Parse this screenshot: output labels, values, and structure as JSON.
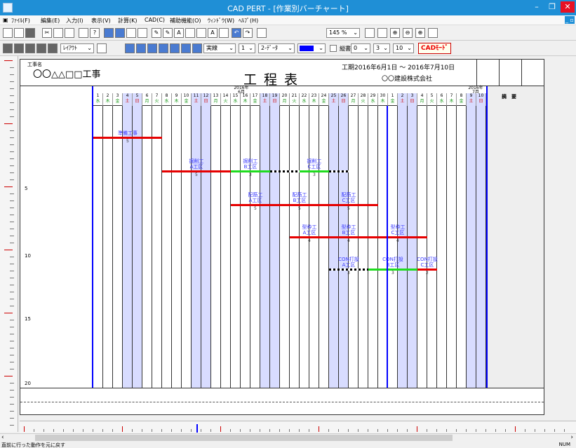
{
  "window": {
    "title": "CAD PERT - [作業別バーチャート]",
    "minimize": "–",
    "maximize": "❐",
    "close": "✕"
  },
  "menu": {
    "items": [
      "ﾌｧｲﾙ(F)",
      "編集(E)",
      "入力(I)",
      "表示(V)",
      "計算(K)",
      "CAD(C)",
      "補助機能(O)",
      "ｳｨﾝﾄﾞｳ(W)",
      "ﾍﾙﾌﾟ(H)"
    ],
    "restore": "_ ▫"
  },
  "toolbar1": {
    "zoom": "145 %"
  },
  "toolbar2": {
    "layout_dropdown": "ﾚｲｱｳﾄ",
    "line_style": "実線",
    "line_width": "1",
    "line_type": "2-ﾃﾞｰﾀ",
    "vertical_checkbox_label": "縦書",
    "font_size_a": "0",
    "font_size_b": "3",
    "font_size_c": "10",
    "cad_button": "CADﾓｰﾄﾞ",
    "line_color": "#0000ff"
  },
  "document": {
    "project_label": "工事名",
    "project_name": "〇〇△△□□工事",
    "title": "工程表",
    "period": "工期2016年6月1日 ～ 2016年7月10日",
    "company": "〇〇建設株式会社",
    "remarks_header": "摘　要",
    "month_june": "2016年\n6月",
    "month_july": "2016年\n7月",
    "row_numbers": [
      "5",
      "10",
      "15",
      "20"
    ]
  },
  "schedule": {
    "day_labels": [
      "1",
      "2",
      "3",
      "4",
      "5",
      "6",
      "7",
      "8",
      "9",
      "10",
      "11",
      "12",
      "13",
      "14",
      "15",
      "16",
      "17",
      "18",
      "19",
      "20",
      "21",
      "22",
      "23",
      "24",
      "25",
      "26",
      "27",
      "28",
      "29",
      "30",
      "1",
      "2",
      "3",
      "4",
      "5",
      "6",
      "7",
      "8",
      "9",
      "10"
    ],
    "weekday_labels": [
      "水",
      "木",
      "金",
      "土",
      "日",
      "月",
      "火",
      "水",
      "木",
      "金",
      "土",
      "日",
      "月",
      "火",
      "水",
      "木",
      "金",
      "土",
      "日",
      "月",
      "火",
      "水",
      "木",
      "金",
      "土",
      "日",
      "月",
      "火",
      "水",
      "木",
      "金",
      "土",
      "日",
      "月",
      "火",
      "水",
      "木",
      "金",
      "土",
      "日"
    ],
    "weekend_index": [
      3,
      4,
      10,
      11,
      17,
      18,
      24,
      25,
      31,
      32,
      38,
      39
    ],
    "tasks": [
      {
        "label": "準備工事",
        "start": 1,
        "end": 8,
        "row": 0,
        "kind": "red",
        "num": "5"
      },
      {
        "label": "掘削工\nA工区",
        "start": 8,
        "end": 15,
        "row": 1,
        "kind": "red",
        "num": "5"
      },
      {
        "label": "掘削工\nB工区",
        "start": 15,
        "end": 19,
        "row": 1,
        "kind": "green",
        "num": "3"
      },
      {
        "label": "",
        "start": 19,
        "end": 22,
        "row": 1,
        "kind": "black-dash",
        "num": ""
      },
      {
        "label": "掘削工\nC工区",
        "start": 22,
        "end": 25,
        "row": 1,
        "kind": "green",
        "num": "3"
      },
      {
        "label": "",
        "start": 25,
        "end": 27,
        "row": 1,
        "kind": "black-dash",
        "num": ""
      },
      {
        "label": "配筋工\nA工区",
        "start": 15,
        "end": 20,
        "row": 2,
        "kind": "red",
        "num": "5"
      },
      {
        "label": "配筋工\nB工区",
        "start": 20,
        "end": 24,
        "row": 2,
        "kind": "red",
        "num": "5"
      },
      {
        "label": "配筋工\nC工区",
        "start": 24,
        "end": 30,
        "row": 2,
        "kind": "red",
        "num": "5"
      },
      {
        "label": "型枠工\nA工区",
        "start": 21,
        "end": 25,
        "row": 3,
        "kind": "red",
        "num": "4"
      },
      {
        "label": "型枠工\nB工区",
        "start": 25,
        "end": 29,
        "row": 3,
        "kind": "red",
        "num": "4"
      },
      {
        "label": "型枠工\nC工区",
        "start": 29,
        "end": 35,
        "row": 3,
        "kind": "red",
        "num": "4"
      },
      {
        "label": "CON打設\nA工区",
        "start": 25,
        "end": 29,
        "row": 4,
        "kind": "black-dash",
        "num": "3"
      },
      {
        "label": "CON打設\nB工区",
        "start": 29,
        "end": 34,
        "row": 4,
        "kind": "green",
        "num": "3"
      },
      {
        "label": "CON打設\nC工区",
        "start": 34,
        "end": 36,
        "row": 4,
        "kind": "red",
        "num": "2"
      }
    ]
  },
  "status": {
    "text": "直前に行った動作を元に戻す",
    "num": "NUM"
  },
  "colors": {
    "accent": "#1f8fd6",
    "weekend": "#d8dcff",
    "critical": "#e60000",
    "normal": "#1fdc1f",
    "month_sep": "#0000ff"
  }
}
